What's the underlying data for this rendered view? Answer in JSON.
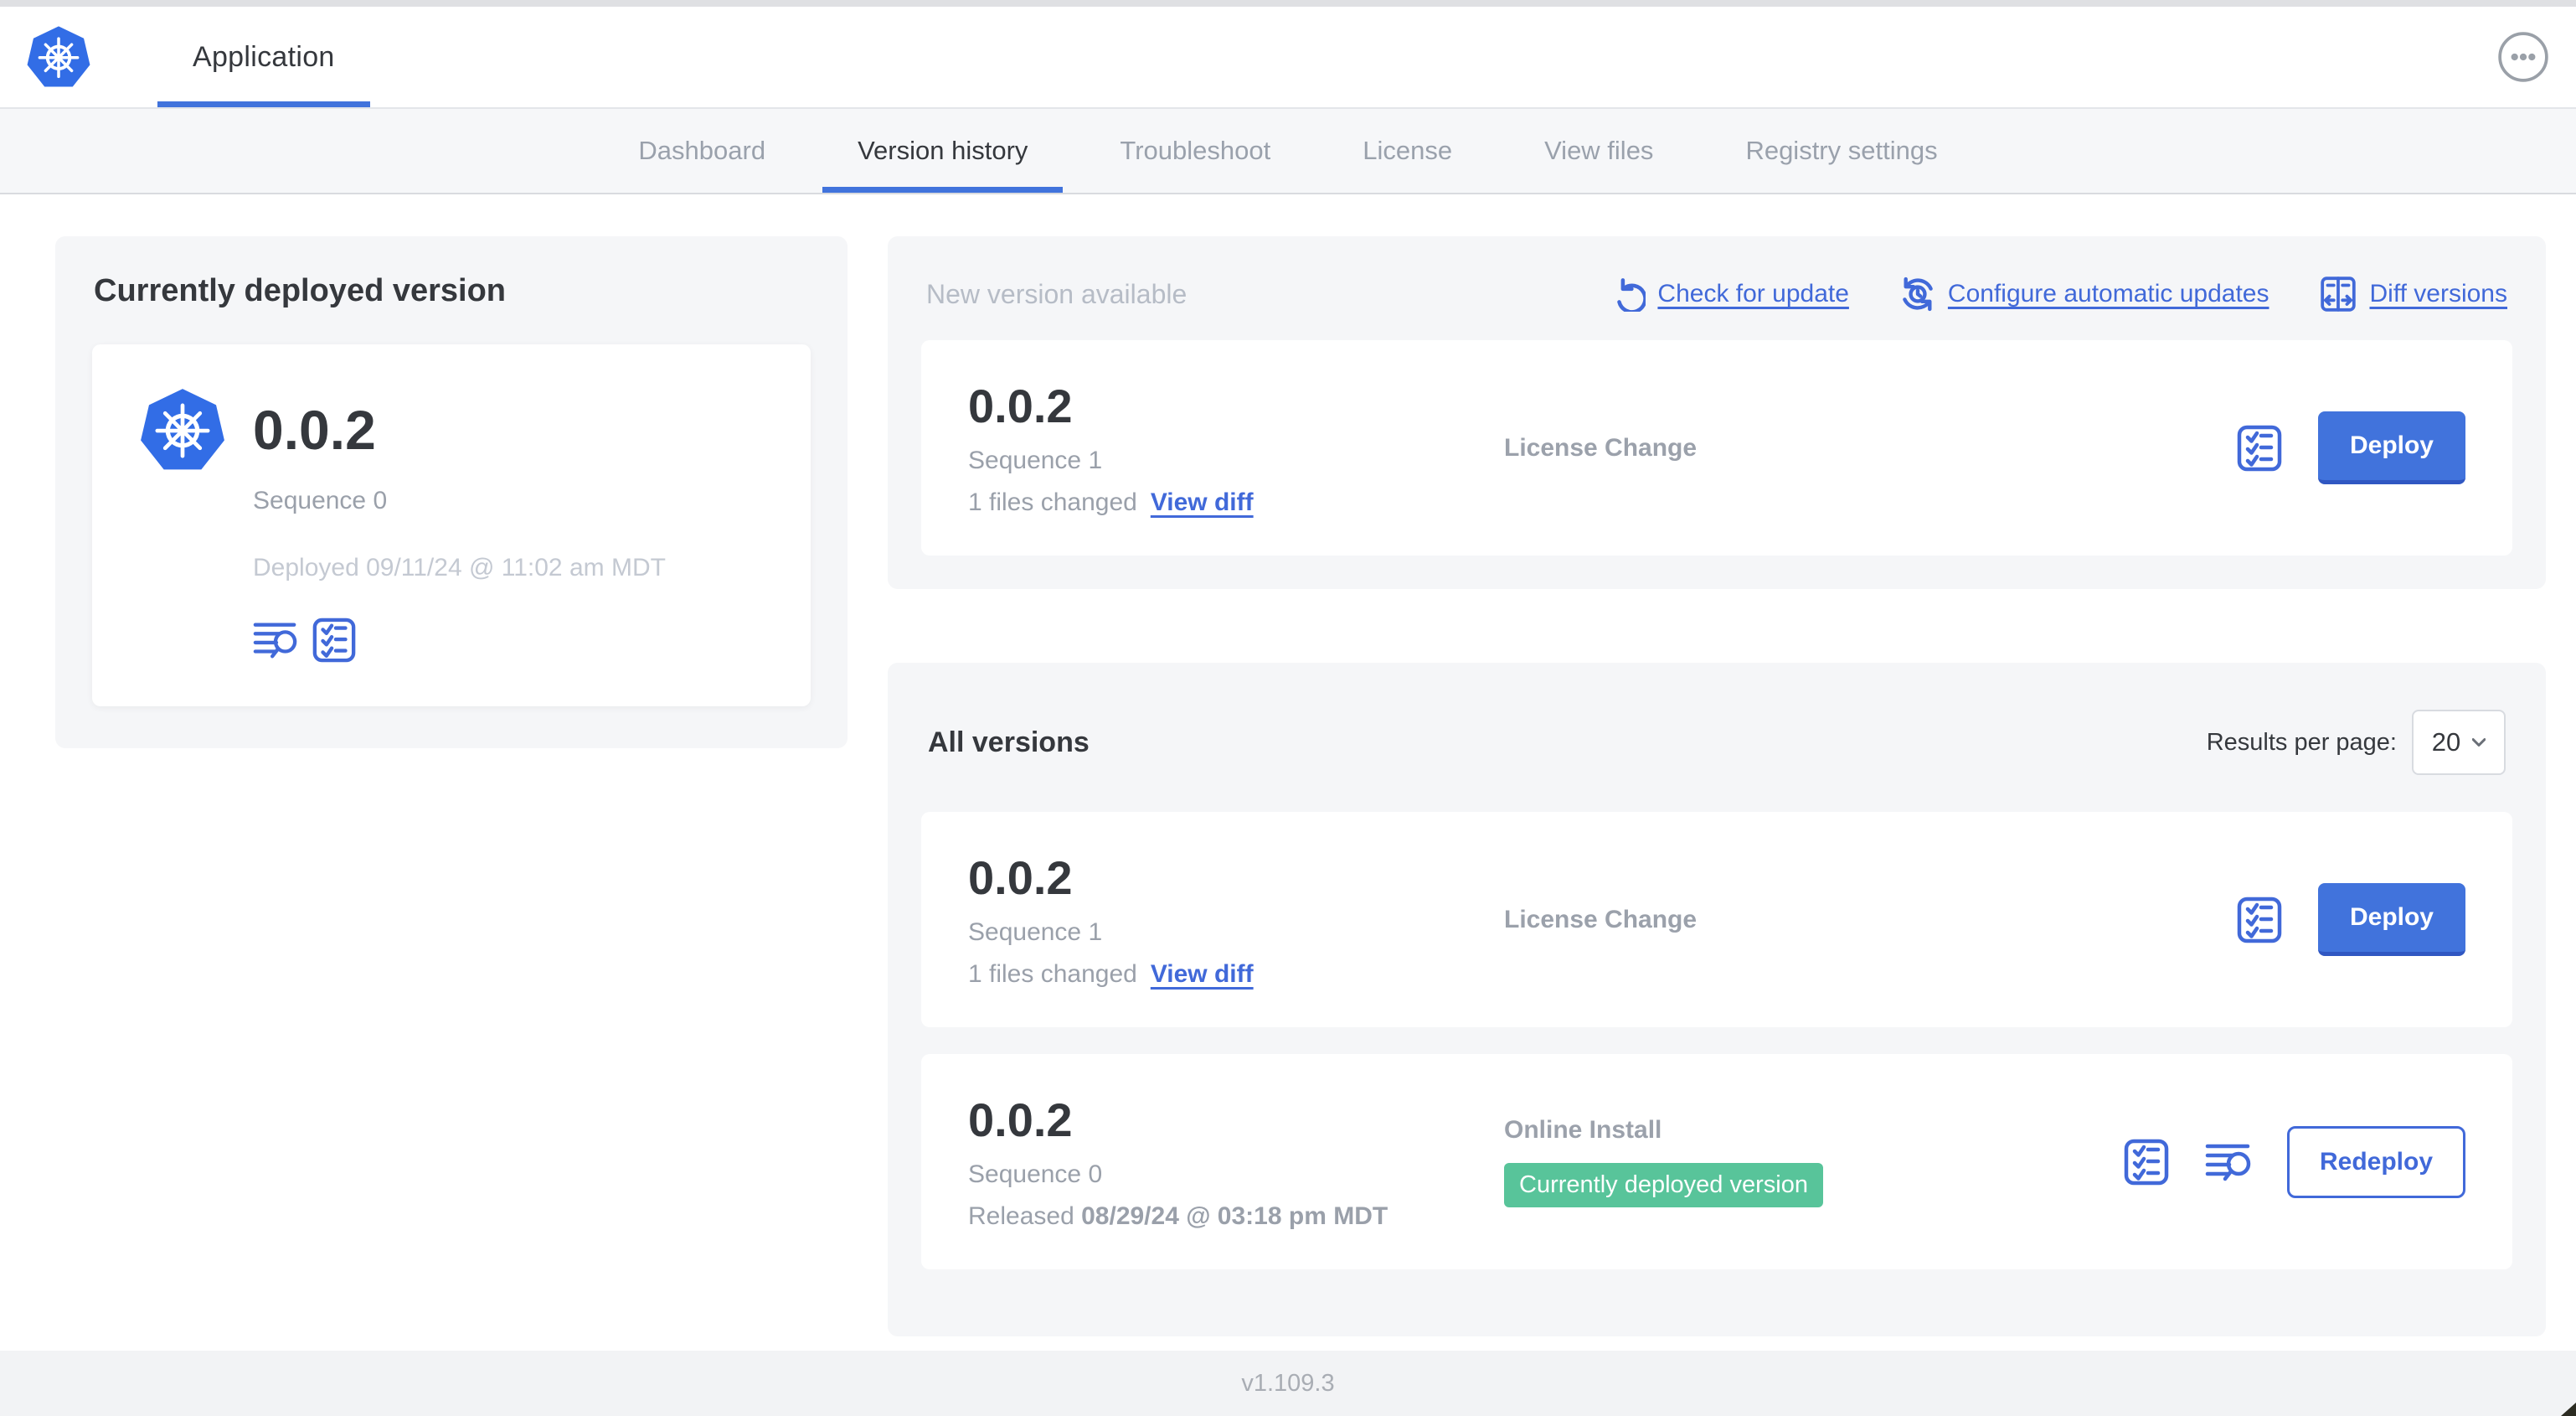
{
  "app": {
    "title": "Application"
  },
  "header": {
    "menu_icon": "ellipsis-menu"
  },
  "nav": {
    "tabs": [
      "Dashboard",
      "Version history",
      "Troubleshoot",
      "License",
      "View files",
      "Registry settings"
    ],
    "active_tab": "Version history"
  },
  "deployed_card": {
    "title": "Currently deployed version",
    "version": "0.0.2",
    "sequence": "Sequence 0",
    "deployed_at": "Deployed 09/11/24 @ 11:02 am MDT",
    "icons": [
      "view-deploy-logs",
      "preflight-checks"
    ]
  },
  "new_version_card": {
    "title": "New version available",
    "actions": [
      {
        "label": "Check for update",
        "icon": "refresh"
      },
      {
        "label": "Configure automatic updates",
        "icon": "schedule-update"
      },
      {
        "label": "Diff versions",
        "icon": "diff"
      }
    ],
    "release": {
      "version": "0.0.2",
      "sequence": "Sequence 1",
      "files_changed": "1 files changed",
      "view_diff_label": "View diff",
      "source": "License Change",
      "action_label": "Deploy"
    }
  },
  "all_versions_card": {
    "title": "All versions",
    "results_per_page_label": "Results per page:",
    "results_per_page_value": "20",
    "releases": [
      {
        "version": "0.0.2",
        "sequence": "Sequence 1",
        "files_changed": "1 files changed",
        "view_diff_label": "View diff",
        "source": "License Change",
        "action_label": "Deploy"
      },
      {
        "version": "0.0.2",
        "sequence": "Sequence 0",
        "released_prefix": "Released",
        "released_date": "08/29/24 @ 03:18 pm MDT",
        "source": "Online Install",
        "badge": "Currently deployed version",
        "action_label": "Redeploy"
      }
    ]
  },
  "footer": {
    "app_version": "v1.109.3"
  },
  "colors": {
    "accent": "#4169d9",
    "button_fill": "#4173dc",
    "button_edge": "#3057c2",
    "badge_green": "#58c49a",
    "k8s_blue": "#326de6",
    "card_bg": "#f5f6f8"
  }
}
